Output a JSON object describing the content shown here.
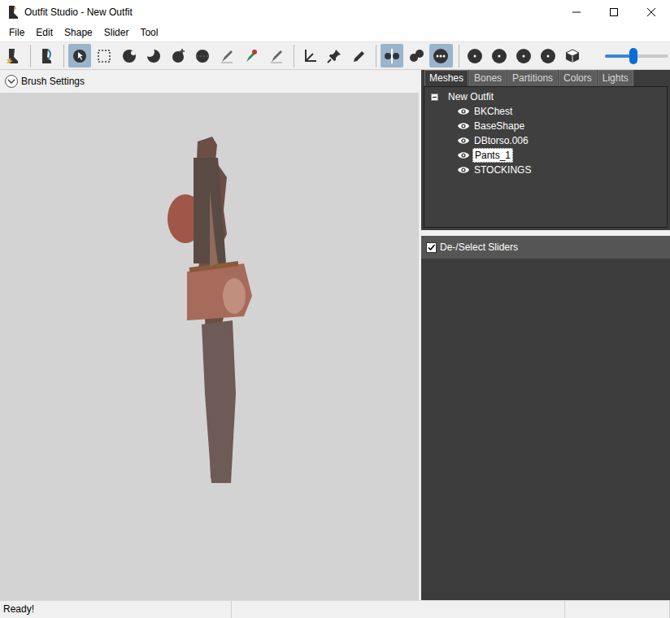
{
  "window": {
    "title": "Outfit Studio - New Outfit"
  },
  "menu": [
    "File",
    "Edit",
    "Shape",
    "Slider",
    "Tool"
  ],
  "toolbar": {
    "groups": [
      [
        {
          "kind": "app",
          "selected": false
        }
      ],
      [
        {
          "kind": "reference",
          "selected": false
        }
      ],
      [
        {
          "kind": "select",
          "selected": true
        },
        {
          "kind": "box",
          "selected": false
        },
        {
          "kind": "brush",
          "selected": false
        },
        {
          "kind": "crescent",
          "selected": false
        },
        {
          "kind": "move",
          "selected": false
        },
        {
          "kind": "smooth",
          "selected": false
        },
        {
          "kind": "pen",
          "selected": false
        },
        {
          "kind": "color",
          "selected": false
        },
        {
          "kind": "pen",
          "selected": false
        }
      ],
      [
        {
          "kind": "transform",
          "selected": false
        },
        {
          "kind": "pin",
          "selected": false
        },
        {
          "kind": "pencil",
          "selected": false
        }
      ],
      [
        {
          "kind": "mirror",
          "selected": true
        },
        {
          "kind": "connected",
          "selected": false
        },
        {
          "kind": "dots",
          "selected": true
        }
      ],
      [
        {
          "kind": "size",
          "selected": false
        },
        {
          "kind": "size",
          "selected": false
        },
        {
          "kind": "size",
          "selected": false
        },
        {
          "kind": "size",
          "selected": false
        },
        {
          "kind": "cube",
          "selected": false
        }
      ]
    ],
    "slider": {
      "level": 0.45
    }
  },
  "brush_settings": {
    "label": "Brush Settings",
    "expanded": false
  },
  "tabs": [
    {
      "label": "Meshes",
      "selected": true
    },
    {
      "label": "Bones",
      "selected": false
    },
    {
      "label": "Partitions",
      "selected": false
    },
    {
      "label": "Colors",
      "selected": false
    },
    {
      "label": "Lights",
      "selected": false
    }
  ],
  "tree": {
    "root": {
      "label": "New Outfit",
      "expanded": true
    },
    "items": [
      {
        "label": "BKChest",
        "visible": true,
        "selected": false
      },
      {
        "label": "BaseShape",
        "visible": true,
        "selected": false
      },
      {
        "label": "DBtorso.006",
        "visible": true,
        "selected": false
      },
      {
        "label": "Pants_1",
        "visible": true,
        "selected": true
      },
      {
        "label": "STOCKINGS",
        "visible": true,
        "selected": false
      }
    ]
  },
  "sliders": {
    "label": "De-/Select Sliders",
    "checked": true
  },
  "status_bar": {
    "text": "Ready!"
  }
}
